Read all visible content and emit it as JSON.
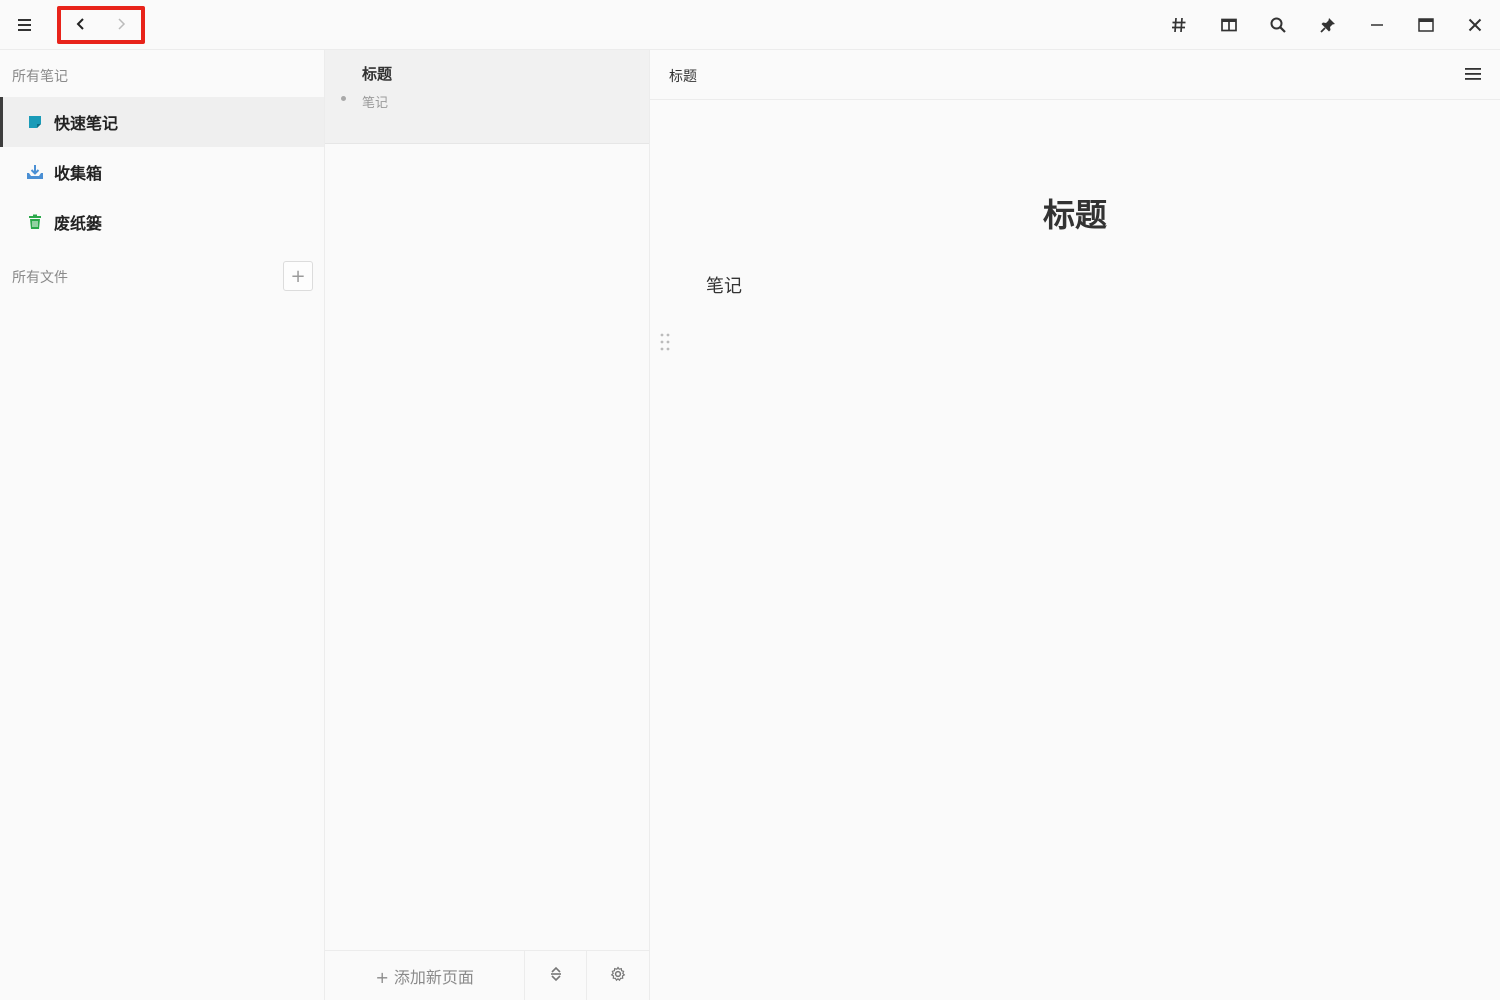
{
  "titlebar": {
    "icons": [
      "menu-icon",
      "chevron-left-icon",
      "chevron-right-icon",
      "hash-icon",
      "split-view-icon",
      "search-icon",
      "pin-icon",
      "minimize-icon",
      "maximize-icon",
      "close-icon"
    ]
  },
  "sidebar": {
    "all_notes_label": "所有笔记",
    "items": [
      {
        "label": "快速笔记",
        "icon": "quick-note-icon",
        "color": "#1a9bb8",
        "active": true
      },
      {
        "label": "收集箱",
        "icon": "inbox-icon",
        "color": "#4a8fd4",
        "active": false
      },
      {
        "label": "废纸篓",
        "icon": "trash-icon",
        "color": "#2aa84a",
        "active": false
      }
    ],
    "all_files_label": "所有文件",
    "add_folder_symbol": "+"
  },
  "notelist": {
    "notes": [
      {
        "title": "标题",
        "snippet": "笔记"
      }
    ],
    "footer": {
      "add_page_label": "+ 添加新页面",
      "sort_icon": "sort-icon",
      "settings_icon": "settings-icon"
    }
  },
  "editor": {
    "breadcrumb": "标题",
    "title": "标题",
    "body": "笔记"
  },
  "colors": {
    "highlight_box": "#e8231a",
    "background": "#fafafa"
  }
}
